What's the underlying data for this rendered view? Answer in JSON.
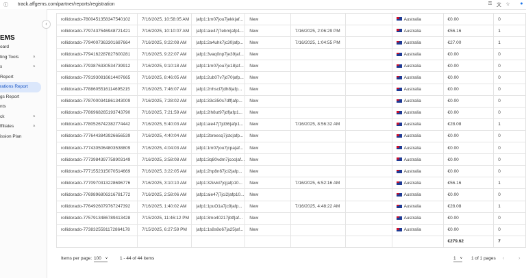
{
  "browser": {
    "url": "track.affgems.com/partner/reports/registration"
  },
  "sidebar": {
    "logo": "EMS",
    "items": [
      {
        "label": "oard",
        "active": false,
        "chevron": false
      },
      {
        "label": "ting Tools",
        "active": false,
        "chevron": true
      },
      {
        "label": "s",
        "active": false,
        "chevron": true
      },
      {
        "label": " Report",
        "active": false,
        "chevron": false
      },
      {
        "label": "rations Report",
        "active": true,
        "chevron": false
      },
      {
        "label": "gs Report",
        "active": false,
        "chevron": false
      },
      {
        "label": "nts",
        "active": false,
        "chevron": false
      },
      {
        "label": "ck",
        "active": false,
        "chevron": true
      },
      {
        "label": "ffiliates",
        "active": false,
        "chevron": true
      },
      {
        "label": "ission Plan",
        "active": false,
        "chevron": false
      }
    ]
  },
  "table": {
    "rows": [
      [
        "rollidorado-7800451358347540102",
        "7/16/2025, 10:58:05 AM",
        "|afp1:1m07jou7jekk|af...",
        "New",
        "",
        "Australia",
        "€0.00",
        "0"
      ],
      [
        "rollidorado-7797437546948721421",
        "7/16/2025, 10:10:07 AM",
        "|afp1:aie47j7ebm|afp1...",
        "New",
        "7/16/2025, 2:06:29 PM",
        "Australia",
        "€56.16",
        "1"
      ],
      [
        "rollidorado-7794007363301687664",
        "7/16/2025, 9:22:08 AM",
        "|afp1:2a4uhk7jc30|afp...",
        "New",
        "7/16/2025, 1:04:55 PM",
        "Australia",
        "€27.00",
        "1"
      ],
      [
        "rollidorado-7794162287827600281",
        "7/16/2025, 9:22:07 AM",
        "|afp1:3vaq0np7je39|af...",
        "New",
        "",
        "Australia",
        "€0.00",
        "0"
      ],
      [
        "rollidorado-7793876330534739912",
        "7/16/2025, 9:10:18 AM",
        "|afp1:1m07jou7je18|af...",
        "New",
        "",
        "Australia",
        "€0.00",
        "0"
      ],
      [
        "rollidorado-7791930816614407665",
        "7/16/2025, 8:46:05 AM",
        "|afp1:2ub07v7jd70|afp...",
        "New",
        "",
        "Australia",
        "€0.00",
        "0"
      ],
      [
        "rollidorado-7788605516114695215",
        "7/16/2025, 7:46:07 AM",
        "|afp1:2nhscl7jdh8|afp...",
        "New",
        "",
        "Australia",
        "€0.00",
        "0"
      ],
      [
        "rollidorado-7787000341861343009",
        "7/16/2025, 7:28:02 AM",
        "|afp1:33c350s7dff|afp...",
        "New",
        "",
        "Australia",
        "€0.00",
        "0"
      ],
      [
        "rollidorado-7786968265193743790",
        "7/16/2025, 7:21:59 AM",
        "|afp1:2lh8ut97jdf|afp1...",
        "New",
        "",
        "Australia",
        "€0.00",
        "0"
      ],
      [
        "rollidorado-7780526742382774442",
        "7/16/2025, 5:40:03 AM",
        "|afp1:aie47j7jd36|afp1...",
        "New",
        "7/16/2025, 8:56:32 AM",
        "Australia",
        "€28.08",
        "1"
      ],
      [
        "rollidorado-7776443843926656539",
        "7/16/2025, 4:40:04 AM",
        "|afp1:2breesq7jctc|afp...",
        "New",
        "",
        "Australia",
        "€0.00",
        "0"
      ],
      [
        "rollidorado-7774305064803538809",
        "7/16/2025, 4:04:03 AM",
        "|afp1:1m07jou7jcpa|af...",
        "New",
        "",
        "Australia",
        "€0.00",
        "0"
      ],
      [
        "rollidorado-7773984397758903149",
        "7/16/2025, 3:58:08 AM",
        "|afp1:3q80vdm7jcoo|af...",
        "New",
        "",
        "Australia",
        "€0.00",
        "0"
      ],
      [
        "rollidorado-7771552315070514669",
        "7/16/2025, 3:22:05 AM",
        "|afp1:2hp8n67jci2|afp...",
        "New",
        "",
        "Australia",
        "€0.00",
        "0"
      ],
      [
        "rollidorado-7770970313228696776",
        "7/16/2025, 3:10:10 AM",
        "|afp1:32i/vkl7jcj|afp10...",
        "New",
        "7/16/2025, 6:52:16 AM",
        "Australia",
        "€56.16",
        "1"
      ],
      [
        "rollidorado-7769896806316781772",
        "7/16/2025, 2:58:06 AM",
        "|afp1:aie47j7jci2|afp10...",
        "New",
        "",
        "Australia",
        "€0.00",
        "0"
      ],
      [
        "rollidorado-7764926079767247392",
        "7/16/2025, 1:40:02 AM",
        "|afp1:1puO1a7jc9|afp...",
        "New",
        "7/16/2025, 4:48:22 AM",
        "Australia",
        "€28.08",
        "1"
      ],
      [
        "rollidorado-7757913486789413428",
        "7/15/2025, 11:46:12 PM",
        "|afp1:3mo40217jbtf|af...",
        "New",
        "",
        "Australia",
        "€0.00",
        "0"
      ],
      [
        "rollidorado-7738325591172864178",
        "7/15/2025, 6:27:59 PM",
        "|afp1:1s8s8o67ja25|af...",
        "New",
        "",
        "Australia",
        "€0.00",
        "0"
      ]
    ],
    "total_amount": "€279.62",
    "total_count": "7"
  },
  "pager": {
    "items_per_page_label": "Items per page:",
    "items_per_page": "100",
    "range": "1 - 44 of 44 items",
    "page": "1",
    "of_pages": "1 of 1 pages"
  }
}
